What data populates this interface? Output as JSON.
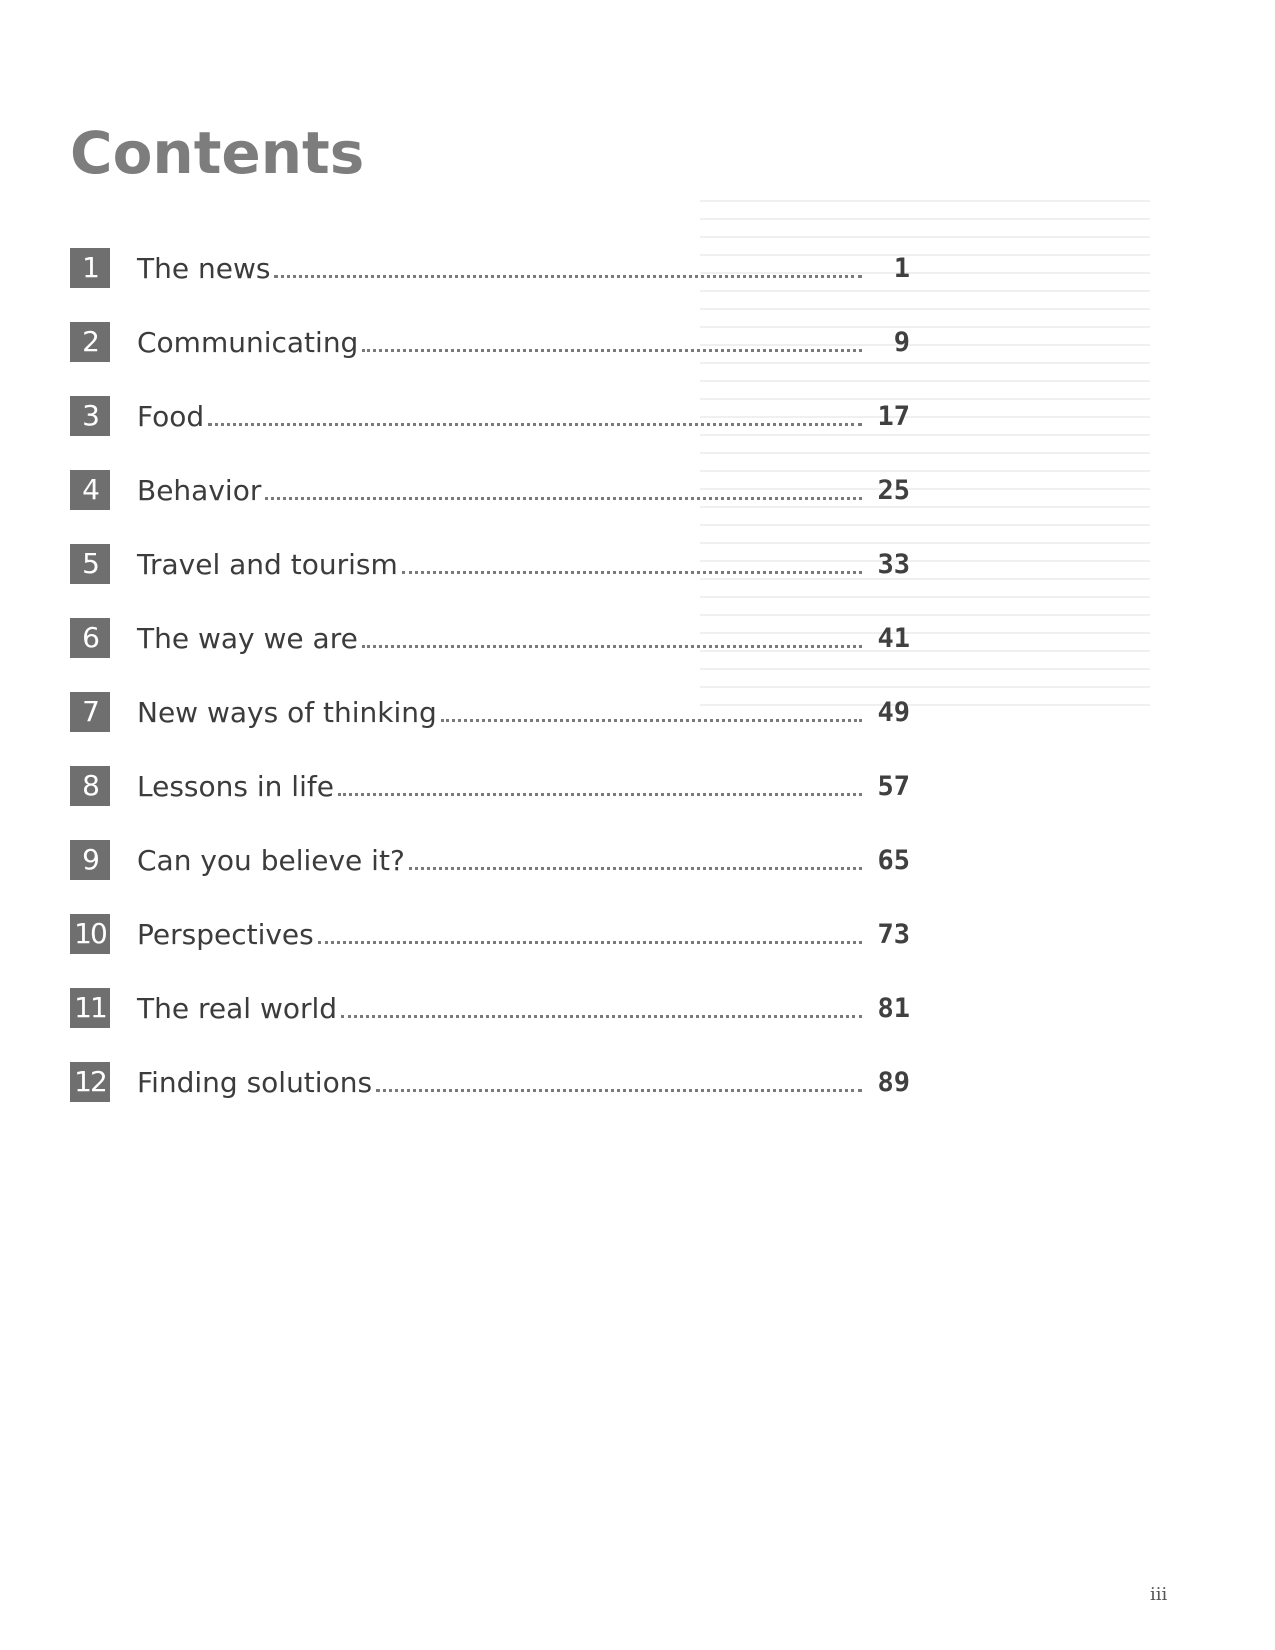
{
  "header": {
    "title": "Contents"
  },
  "toc": [
    {
      "number": "1",
      "title": "The news",
      "page": "1"
    },
    {
      "number": "2",
      "title": "Communicating",
      "page": "9"
    },
    {
      "number": "3",
      "title": "Food",
      "page": "17"
    },
    {
      "number": "4",
      "title": "Behavior",
      "page": "25"
    },
    {
      "number": "5",
      "title": "Travel and tourism",
      "page": "33"
    },
    {
      "number": "6",
      "title": "The way we are",
      "page": "41"
    },
    {
      "number": "7",
      "title": "New ways of thinking",
      "page": "49"
    },
    {
      "number": "8",
      "title": "Lessons in life",
      "page": "57"
    },
    {
      "number": "9",
      "title": "Can you believe it?",
      "page": "65"
    },
    {
      "number": "10",
      "title": "Perspectives",
      "page": "73"
    },
    {
      "number": "11",
      "title": "The real world",
      "page": "81"
    },
    {
      "number": "12",
      "title": "Finding solutions",
      "page": "89"
    }
  ],
  "footer": {
    "page_number": "iii"
  }
}
